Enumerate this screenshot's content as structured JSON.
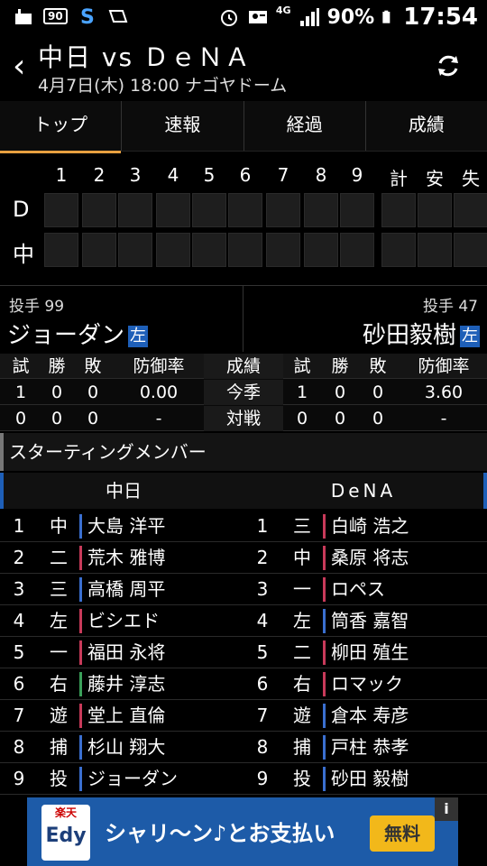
{
  "status_bar": {
    "badge": "90",
    "network": "4G",
    "battery": "90%",
    "time": "17:54"
  },
  "header": {
    "title": "中日 vs ＤｅＮＡ",
    "subtitle": "4月7日(木) 18:00 ナゴヤドーム"
  },
  "tabs": [
    {
      "label": "トップ",
      "active": true
    },
    {
      "label": "速報"
    },
    {
      "label": "経過"
    },
    {
      "label": "成績"
    }
  ],
  "scoreboard": {
    "innings": [
      "1",
      "2",
      "3",
      "4",
      "5",
      "6",
      "7",
      "8",
      "9"
    ],
    "totals": [
      "計",
      "安",
      "失"
    ],
    "teams": [
      "D",
      "中"
    ]
  },
  "pitchers": {
    "home": {
      "label": "投手 99",
      "name": "ジョーダン",
      "hand": "左"
    },
    "away": {
      "label": "投手 47",
      "name": "砂田毅樹",
      "hand": "左"
    }
  },
  "stats": {
    "headers": [
      "試",
      "勝",
      "敗",
      "防御率"
    ],
    "center_header": "成績",
    "rows": [
      {
        "label": "今季",
        "home": [
          "1",
          "0",
          "0",
          "0.00"
        ],
        "away": [
          "1",
          "0",
          "0",
          "3.60"
        ]
      },
      {
        "label": "対戦",
        "home": [
          "0",
          "0",
          "0",
          "-"
        ],
        "away": [
          "0",
          "0",
          "0",
          "-"
        ]
      }
    ]
  },
  "starting": {
    "title": "スターティングメンバー",
    "home_team": "中日",
    "away_team": "DeNA",
    "home": [
      {
        "no": "1",
        "pos": "中",
        "name": "大島 洋平"
      },
      {
        "no": "2",
        "pos": "二",
        "name": "荒木 雅博"
      },
      {
        "no": "3",
        "pos": "三",
        "name": "高橋 周平"
      },
      {
        "no": "4",
        "pos": "左",
        "name": "ビシエド"
      },
      {
        "no": "5",
        "pos": "一",
        "name": "福田 永将"
      },
      {
        "no": "6",
        "pos": "右",
        "name": "藤井 淳志"
      },
      {
        "no": "7",
        "pos": "遊",
        "name": "堂上 直倫"
      },
      {
        "no": "8",
        "pos": "捕",
        "name": "杉山 翔大"
      },
      {
        "no": "9",
        "pos": "投",
        "name": "ジョーダン"
      }
    ],
    "away": [
      {
        "no": "1",
        "pos": "三",
        "name": "白崎 浩之"
      },
      {
        "no": "2",
        "pos": "中",
        "name": "桑原 将志"
      },
      {
        "no": "3",
        "pos": "一",
        "name": "ロペス"
      },
      {
        "no": "4",
        "pos": "左",
        "name": "筒香 嘉智"
      },
      {
        "no": "5",
        "pos": "二",
        "name": "柳田 殖生"
      },
      {
        "no": "6",
        "pos": "右",
        "name": "ロマック"
      },
      {
        "no": "7",
        "pos": "遊",
        "name": "倉本 寿彦"
      },
      {
        "no": "8",
        "pos": "捕",
        "name": "戸柱 恭孝"
      },
      {
        "no": "9",
        "pos": "投",
        "name": "砂田 毅樹"
      }
    ]
  },
  "ad": {
    "logo_top": "楽天",
    "logo_main": "Edy",
    "text": "シャリ〜ン♪とお支払い",
    "button": "無料",
    "info": "i"
  }
}
